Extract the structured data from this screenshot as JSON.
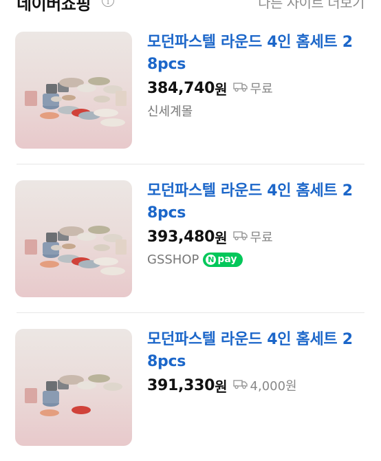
{
  "header": {
    "title": "네이버쇼핑",
    "link": "다른 사이트 더보기"
  },
  "products": [
    {
      "title_line1": "모던파스텔 라운드 4인 홈세트 2",
      "title_line2": "8pcs",
      "price": "384,740",
      "currency": "원",
      "shipping": "무료",
      "seller": "신세계몰",
      "badge": ""
    },
    {
      "title_line1": "모던파스텔 라운드 4인 홈세트 2",
      "title_line2": "8pcs",
      "price": "393,480",
      "currency": "원",
      "shipping": "무료",
      "seller": "GSSHOP",
      "badge": "pay"
    },
    {
      "title_line1": "모던파스텔 라운드 4인 홈세트 2",
      "title_line2": "8pcs",
      "price": "391,330",
      "currency": "원",
      "shipping": "4,000원",
      "seller": "",
      "badge": ""
    }
  ],
  "colors": {
    "title_blue": "#1b66c9",
    "npay_green": "#03c75a",
    "thumb_background": "#f0dfe0"
  }
}
